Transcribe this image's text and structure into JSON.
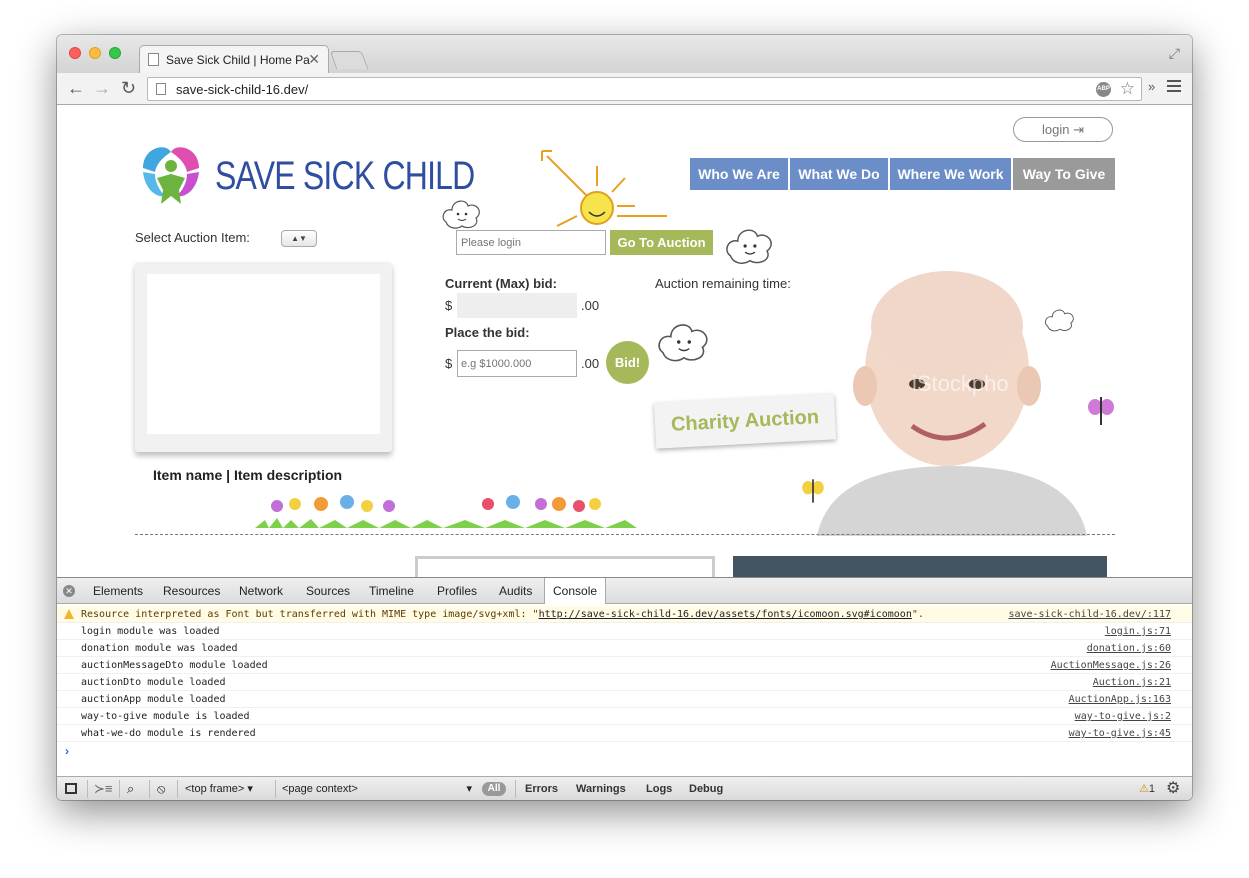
{
  "browser": {
    "tab_title": "Save Sick Child | Home Pa",
    "url": "save-sick-child-16.dev/"
  },
  "page": {
    "login_label": "login",
    "logo_text": "SAVE SICK CHILD",
    "nav": [
      "Who We Are",
      "What We Do",
      "Where We Work",
      "Way To Give"
    ],
    "select_label": "Select Auction Item:",
    "item_caption": "Item name | Item description",
    "login_placeholder": "Please login",
    "go_to_auction": "Go To Auction",
    "current_bid_label": "Current (Max) bid:",
    "currency": "$",
    "cents": ".00",
    "place_bid_label": "Place the bid:",
    "bid_placeholder": "e.g $1000.000",
    "bid_button": "Bid!",
    "remaining_label": "Auction remaining time:",
    "charity_badge": "Charity Auction"
  },
  "devtools": {
    "tabs": [
      "Elements",
      "Resources",
      "Network",
      "Sources",
      "Timeline",
      "Profiles",
      "Audits",
      "Console"
    ],
    "active_tab": "Console",
    "warning": {
      "prefix": "Resource interpreted as Font but transferred with MIME type image/svg+xml: \"",
      "link": "http://save-sick-child-16.dev/assets/fonts/icomoon.svg#icomoon",
      "suffix": "\".",
      "source": "save-sick-child-16.dev/:117"
    },
    "logs": [
      {
        "msg": "login module was loaded",
        "src": "login.js:71"
      },
      {
        "msg": "donation module was loaded",
        "src": "donation.js:60"
      },
      {
        "msg": "auctionMessageDto module loaded",
        "src": "AuctionMessage.js:26"
      },
      {
        "msg": "auctionDto module loaded",
        "src": "Auction.js:21"
      },
      {
        "msg": "auctionApp module loaded",
        "src": "AuctionApp.js:163"
      },
      {
        "msg": "way-to-give module is loaded",
        "src": "way-to-give.js:2"
      },
      {
        "msg": "what-we-do module is rendered",
        "src": "way-to-give.js:45"
      }
    ],
    "status": {
      "frame": "<top frame>",
      "context": "<page context>",
      "all": "All",
      "filters": [
        "Errors",
        "Warnings",
        "Logs",
        "Debug"
      ],
      "warning_count": "1"
    }
  },
  "colors": {
    "nav_blue": "#6b8dc8",
    "accent_green": "#a5b85a",
    "logo_blue": "#2f4ea0"
  }
}
